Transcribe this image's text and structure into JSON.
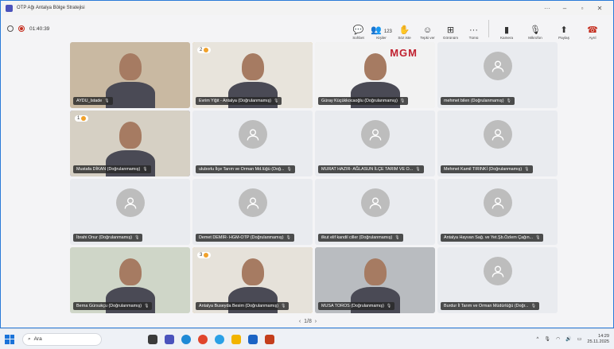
{
  "window": {
    "title": "OTP Ağı  Antalya Bölge Stratejisi",
    "timer": "01:40:39"
  },
  "toolbar": {
    "tools": [
      {
        "icon": "chat-icon",
        "label": "Sohbet"
      },
      {
        "icon": "people-icon",
        "label": "Kişiler",
        "count": "123"
      },
      {
        "icon": "raise-hand-icon",
        "label": "Söz iste"
      },
      {
        "icon": "reaction-icon",
        "label": "Tepki ver"
      },
      {
        "icon": "view-icon",
        "label": "Görünüm"
      },
      {
        "icon": "more-icon",
        "label": "Tümü"
      },
      {
        "icon": "camera-icon",
        "label": "Kamera"
      },
      {
        "icon": "microphone-icon",
        "label": "Mikrofon"
      },
      {
        "icon": "share-icon",
        "label": "Paylaş"
      },
      {
        "icon": "leave-icon",
        "label": "Ayrıl"
      }
    ]
  },
  "participants": [
    {
      "name": "AYDU_Istade",
      "video": true,
      "bg": "#c9b9a2"
    },
    {
      "name": "Evrim Yiğit - Antalya (Doğrulanmamış)",
      "video": true,
      "badge": "2",
      "highlight": "active",
      "bg": "#e8e4dc"
    },
    {
      "name": "Güray Küçükkocaoğlu (Doğrulanmamış)",
      "video": true,
      "bg": "#f2f2f2",
      "logo": "MGM"
    },
    {
      "name": "mehmet bilen (Doğrulanmamış)",
      "video": false
    },
    {
      "name": "Mustafa DİKAN (Doğrulanmamış)",
      "video": true,
      "badge": "1",
      "highlight": "speaking",
      "bg": "#d6d0c4"
    },
    {
      "name": "uluborlu İlçe Tarım ve Orman Md.lüğü (Doğ...",
      "video": false
    },
    {
      "name": "MURAT HAZIR- AĞLASUN İLÇE TARIM VE O...",
      "video": false
    },
    {
      "name": "Mehmet Kamil TIRINKİ (Doğrulanmamış)",
      "video": false
    },
    {
      "name": "İbrahi Onur (Doğrulanmamış)",
      "video": false
    },
    {
      "name": "Demet DEMİR- HGM-OTP (Doğrulanmamış)",
      "video": false
    },
    {
      "name": "ilkut elif kandil ciller (Doğrulanmamış)",
      "video": false
    },
    {
      "name": "Antalya Hayvan Sağ. ve Yet.Şb.Özlem Çağın...",
      "video": false
    },
    {
      "name": "Berna Gürsukçu (Doğrulanmamış)",
      "video": true,
      "bg": "#cfd6c8"
    },
    {
      "name": "Antalya Buseyda Besim (Doğrulanmamış)",
      "video": true,
      "badge": "3",
      "highlight": "active",
      "bg": "#e6e2da"
    },
    {
      "name": "MUSA TOROS (Doğrulanmamış)",
      "video": true,
      "bg": "#b9bcc0"
    },
    {
      "name": "Burdur İl Tarım ve Orman Müdürlüğü (Doğr...",
      "video": false
    }
  ],
  "pager": "1/8",
  "taskbar": {
    "search_placeholder": "Ara",
    "time": "14:29",
    "date": "25.11.2025"
  }
}
